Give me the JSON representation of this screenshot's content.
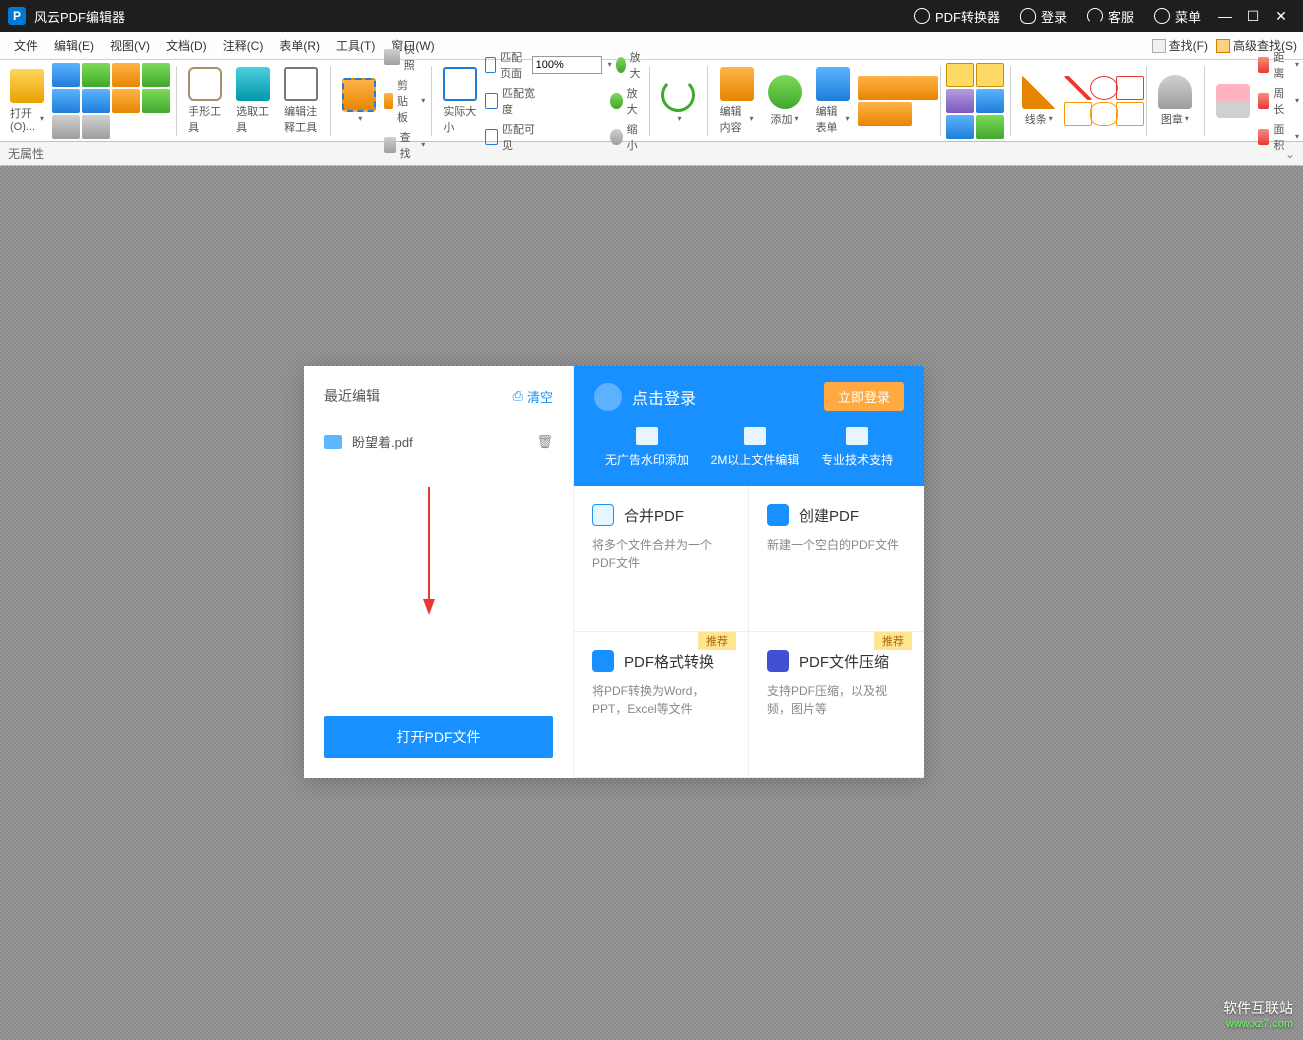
{
  "titlebar": {
    "app_name": "风云PDF编辑器",
    "converter": "PDF转换器",
    "login": "登录",
    "support": "客服",
    "menu": "菜单"
  },
  "menubar": {
    "items": [
      "文件",
      "编辑(E)",
      "视图(V)",
      "文档(D)",
      "注释(C)",
      "表单(R)",
      "工具(T)",
      "窗口(W)"
    ],
    "find": "查找(F)",
    "adv_find": "高级查找(S)"
  },
  "toolbar": {
    "open": "打开(O)...",
    "hand": "手形工具",
    "select": "选取工具",
    "annotate": "编辑注释工具",
    "snapshot": "快照",
    "clipboard": "剪贴板",
    "find": "查找",
    "actual": "实际大小",
    "fit_page": "匹配页面",
    "fit_width": "匹配宽度",
    "fit_visible": "匹配可见",
    "zoom_in": "放大",
    "zoom_out": "缩小",
    "zoom_value": "100%",
    "edit_content": "编辑内容",
    "add": "添加",
    "edit_form": "编辑表单",
    "lines": "线条",
    "stamp": "图章",
    "distance": "距离",
    "perimeter": "周长",
    "area": "面积"
  },
  "propbar": {
    "no_attr": "无属性"
  },
  "welcome": {
    "recent_title": "最近编辑",
    "clear": "清空",
    "recent_file": "盼望着.pdf",
    "open_btn": "打开PDF文件",
    "click_login": "点击登录",
    "login_now": "立即登录",
    "features": [
      "无广告水印添加",
      "2M以上文件编辑",
      "专业技术支持"
    ],
    "cards": [
      {
        "title": "合并PDF",
        "desc": "将多个文件合并为一个PDF文件",
        "tag": "",
        "icon_bg": "#1890ff"
      },
      {
        "title": "创建PDF",
        "desc": "新建一个空白的PDF文件",
        "tag": "",
        "icon_bg": "#1890ff"
      },
      {
        "title": "PDF格式转换",
        "desc": "将PDF转换为Word，PPT，Excel等文件",
        "tag": "推荐",
        "icon_bg": "#1890ff"
      },
      {
        "title": "PDF文件压缩",
        "desc": "支持PDF压缩，以及视频，图片等",
        "tag": "推荐",
        "icon_bg": "#4050d0"
      }
    ]
  },
  "watermark": {
    "main": "软件互联站",
    "sub": "www.xz7.com"
  }
}
